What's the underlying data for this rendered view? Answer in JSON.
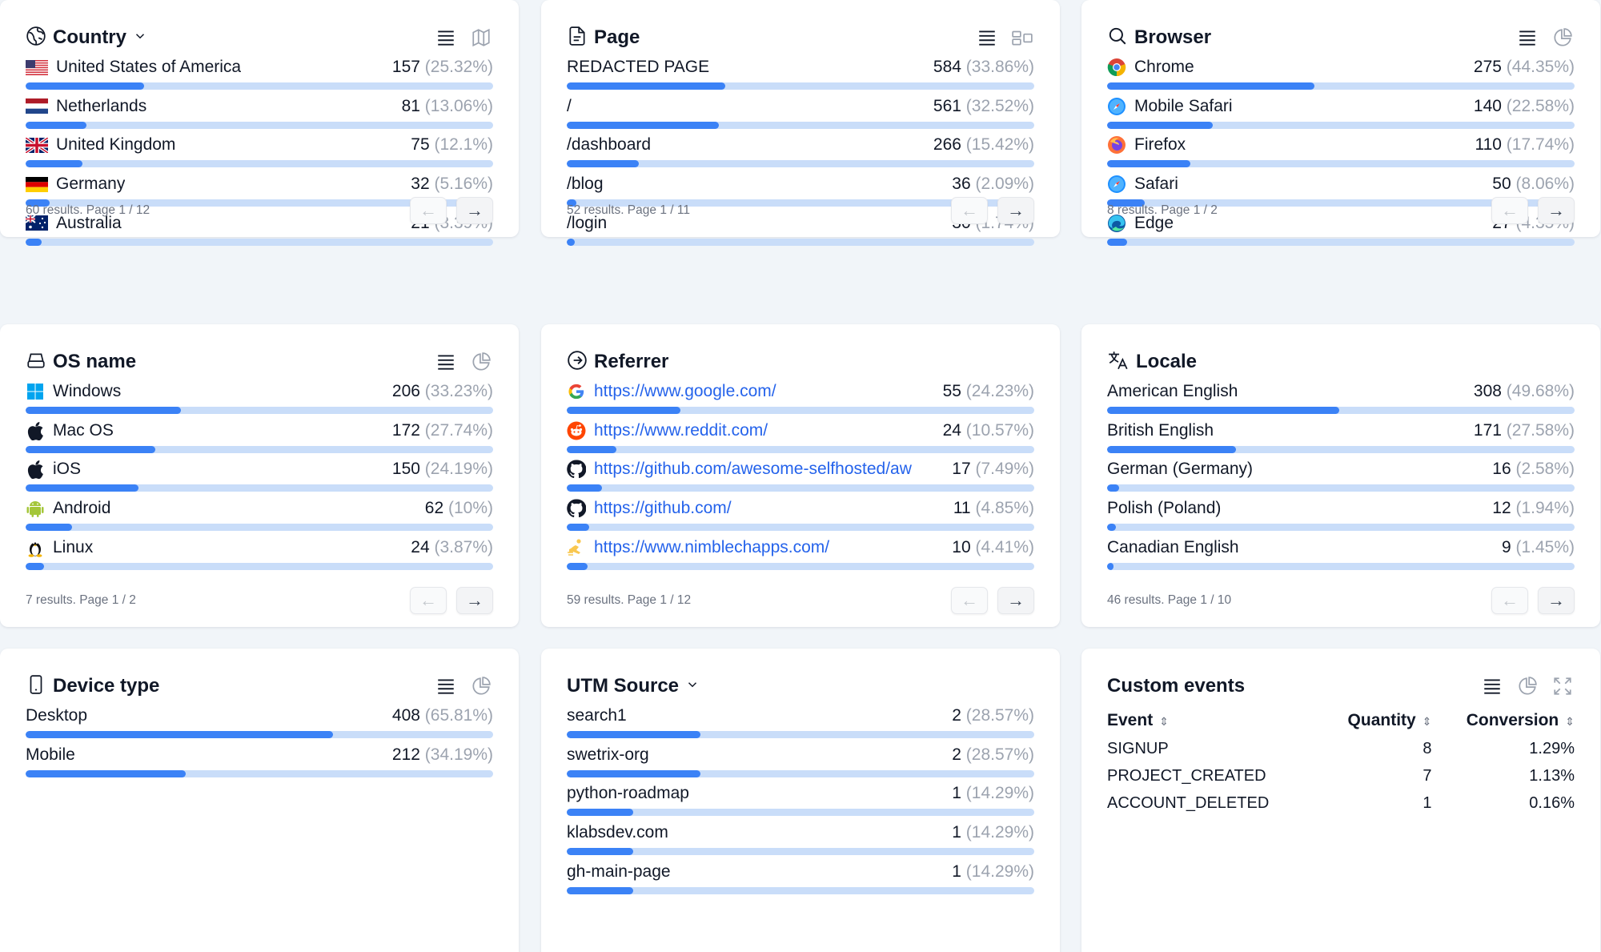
{
  "accent": "#3b82f6",
  "bar_bg": "#c9ddf9",
  "country": {
    "title": "Country",
    "rows": [
      {
        "name": "United States of America",
        "count": "157",
        "pct": "(25.32%)",
        "share": 25.32,
        "icon": "flag-us"
      },
      {
        "name": "Netherlands",
        "count": "81",
        "pct": "(13.06%)",
        "share": 13.06,
        "icon": "flag-nl"
      },
      {
        "name": "United Kingdom",
        "count": "75",
        "pct": "(12.1%)",
        "share": 12.1,
        "icon": "flag-gb"
      },
      {
        "name": "Germany",
        "count": "32",
        "pct": "(5.16%)",
        "share": 5.16,
        "icon": "flag-de"
      },
      {
        "name": "Australia",
        "count": "21",
        "pct": "(3.39%)",
        "share": 3.39,
        "icon": "flag-au"
      }
    ],
    "footer": "60 results. Page 1 / 12"
  },
  "page": {
    "title": "Page",
    "rows": [
      {
        "name": "REDACTED PAGE",
        "count": "584",
        "pct": "(33.86%)",
        "share": 33.86
      },
      {
        "name": "/",
        "count": "561",
        "pct": "(32.52%)",
        "share": 32.52
      },
      {
        "name": "/dashboard",
        "count": "266",
        "pct": "(15.42%)",
        "share": 15.42
      },
      {
        "name": "/blog",
        "count": "36",
        "pct": "(2.09%)",
        "share": 2.09
      },
      {
        "name": "/login",
        "count": "30",
        "pct": "(1.74%)",
        "share": 1.74
      }
    ],
    "footer": "52 results. Page 1 / 11"
  },
  "browser": {
    "title": "Browser",
    "rows": [
      {
        "name": "Chrome",
        "count": "275",
        "pct": "(44.35%)",
        "share": 44.35,
        "icon": "chrome-icon"
      },
      {
        "name": "Mobile Safari",
        "count": "140",
        "pct": "(22.58%)",
        "share": 22.58,
        "icon": "safari-icon"
      },
      {
        "name": "Firefox",
        "count": "110",
        "pct": "(17.74%)",
        "share": 17.74,
        "icon": "firefox-icon"
      },
      {
        "name": "Safari",
        "count": "50",
        "pct": "(8.06%)",
        "share": 8.06,
        "icon": "safari-icon"
      },
      {
        "name": "Edge",
        "count": "27",
        "pct": "(4.35%)",
        "share": 4.35,
        "icon": "edge-icon"
      }
    ],
    "footer": "8 results. Page 1 / 2"
  },
  "os": {
    "title": "OS name",
    "rows": [
      {
        "name": "Windows",
        "count": "206",
        "pct": "(33.23%)",
        "share": 33.23,
        "icon": "windows-icon"
      },
      {
        "name": "Mac OS",
        "count": "172",
        "pct": "(27.74%)",
        "share": 27.74,
        "icon": "apple-icon"
      },
      {
        "name": "iOS",
        "count": "150",
        "pct": "(24.19%)",
        "share": 24.19,
        "icon": "apple-icon"
      },
      {
        "name": "Android",
        "count": "62",
        "pct": "(10%)",
        "share": 10,
        "icon": "android-icon"
      },
      {
        "name": "Linux",
        "count": "24",
        "pct": "(3.87%)",
        "share": 3.87,
        "icon": "linux-icon"
      }
    ],
    "footer": "7 results. Page 1 / 2"
  },
  "referrer": {
    "title": "Referrer",
    "rows": [
      {
        "name": "https://www.google.com/",
        "count": "55",
        "pct": "(24.23%)",
        "share": 24.23,
        "icon": "google-icon"
      },
      {
        "name": "https://www.reddit.com/",
        "count": "24",
        "pct": "(10.57%)",
        "share": 10.57,
        "icon": "reddit-icon"
      },
      {
        "name": "https://github.com/awesome-selfhosted/aw",
        "count": "17",
        "pct": "(7.49%)",
        "share": 7.49,
        "icon": "github-icon"
      },
      {
        "name": "https://github.com/",
        "count": "11",
        "pct": "(4.85%)",
        "share": 4.85,
        "icon": "github-icon"
      },
      {
        "name": "https://www.nimblechapps.com/",
        "count": "10",
        "pct": "(4.41%)",
        "share": 4.41,
        "icon": "nimblechapps-icon"
      }
    ],
    "footer": "59 results. Page 1 / 12"
  },
  "locale": {
    "title": "Locale",
    "rows": [
      {
        "name": "American English",
        "count": "308",
        "pct": "(49.68%)",
        "share": 49.68
      },
      {
        "name": "British English",
        "count": "171",
        "pct": "(27.58%)",
        "share": 27.58
      },
      {
        "name": "German (Germany)",
        "count": "16",
        "pct": "(2.58%)",
        "share": 2.58
      },
      {
        "name": "Polish (Poland)",
        "count": "12",
        "pct": "(1.94%)",
        "share": 1.94
      },
      {
        "name": "Canadian English",
        "count": "9",
        "pct": "(1.45%)",
        "share": 1.45
      }
    ],
    "footer": "46 results. Page 1 / 10"
  },
  "device": {
    "title": "Device type",
    "rows": [
      {
        "name": "Desktop",
        "count": "408",
        "pct": "(65.81%)",
        "share": 65.81
      },
      {
        "name": "Mobile",
        "count": "212",
        "pct": "(34.19%)",
        "share": 34.19
      }
    ]
  },
  "utm": {
    "title": "UTM Source",
    "rows": [
      {
        "name": "search1",
        "count": "2",
        "pct": "(28.57%)",
        "share": 28.57
      },
      {
        "name": "swetrix-org",
        "count": "2",
        "pct": "(28.57%)",
        "share": 28.57
      },
      {
        "name": "python-roadmap",
        "count": "1",
        "pct": "(14.29%)",
        "share": 14.29
      },
      {
        "name": "klabsdev.com",
        "count": "1",
        "pct": "(14.29%)",
        "share": 14.29
      },
      {
        "name": "gh-main-page",
        "count": "1",
        "pct": "(14.29%)",
        "share": 14.29
      }
    ]
  },
  "custom_events": {
    "title": "Custom events",
    "headers": {
      "event": "Event",
      "quantity": "Quantity",
      "conversion": "Conversion"
    },
    "rows": [
      {
        "event": "SIGNUP",
        "quantity": "8",
        "conversion": "1.29%"
      },
      {
        "event": "PROJECT_CREATED",
        "quantity": "7",
        "conversion": "1.13%"
      },
      {
        "event": "ACCOUNT_DELETED",
        "quantity": "1",
        "conversion": "0.16%"
      }
    ]
  },
  "pager": {
    "prev": "←",
    "next": "→"
  }
}
